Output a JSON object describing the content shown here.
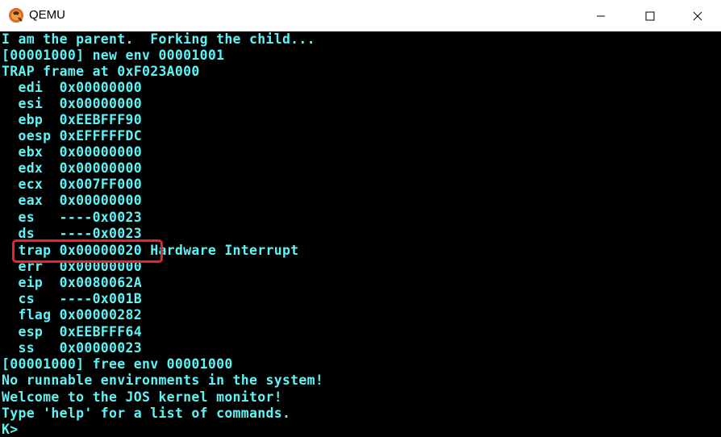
{
  "window": {
    "title": "QEMU",
    "app_icon": "qemu-logo-icon",
    "controls": {
      "minimize_icon": "minimize-icon",
      "maximize_icon": "maximize-icon",
      "close_icon": "close-icon"
    }
  },
  "colors": {
    "console_background": "#000000",
    "console_text": "#5ff3f5",
    "highlight_border": "#e8242b"
  },
  "console": {
    "lines": [
      "I am the parent.  Forking the child...",
      "[00001000] new env 00001001",
      "TRAP frame at 0xF023A000",
      "  edi  0x00000000",
      "  esi  0x00000000",
      "  ebp  0xEEBFFF90",
      "  oesp 0xEFFFFFDC",
      "  ebx  0x00000000",
      "  edx  0x00000000",
      "  ecx  0x007FF000",
      "  eax  0x00000000",
      "  es   ----0x0023",
      "  ds   ----0x0023",
      "  trap 0x00000020 Hardware Interrupt",
      "  err  0x00000000",
      "  eip  0x0080062A",
      "  cs   ----0x001B",
      "  flag 0x00000282",
      "  esp  0xEEBFFF64",
      "  ss   0x00000023",
      "[00001000] free env 00001000",
      "No runnable environments in the system!",
      "Welcome to the JOS kernel monitor!",
      "Type 'help' for a list of commands.",
      "K>"
    ]
  }
}
